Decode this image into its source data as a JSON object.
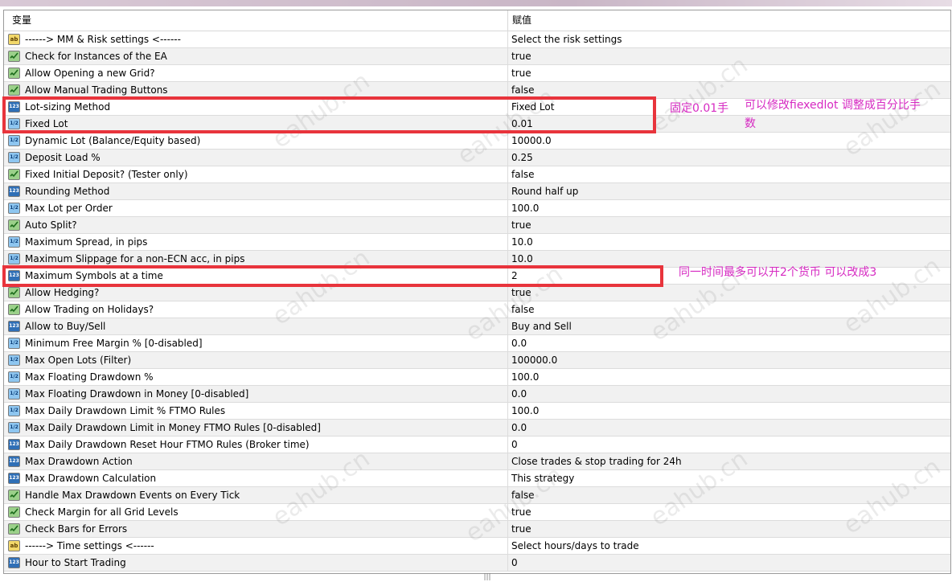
{
  "header": {
    "variable": "变量",
    "value": "赋值"
  },
  "rows": [
    {
      "icon": "ab",
      "label": "------> MM & Risk settings <------",
      "value": "Select the risk settings"
    },
    {
      "icon": "bool",
      "label": "Check for Instances of the EA",
      "value": "true"
    },
    {
      "icon": "bool",
      "label": "Allow Opening a new Grid?",
      "value": "true"
    },
    {
      "icon": "bool",
      "label": "Allow Manual Trading Buttons",
      "value": "false"
    },
    {
      "icon": "123",
      "label": "Lot-sizing Method",
      "value": "Fixed Lot"
    },
    {
      "icon": "v2",
      "label": "Fixed Lot",
      "value": "0.01"
    },
    {
      "icon": "v2",
      "label": "Dynamic Lot (Balance/Equity based)",
      "value": "10000.0"
    },
    {
      "icon": "v2",
      "label": "Deposit Load %",
      "value": "0.25"
    },
    {
      "icon": "bool",
      "label": "Fixed Initial Deposit? (Tester only)",
      "value": "false"
    },
    {
      "icon": "123",
      "label": "Rounding Method",
      "value": "Round half up"
    },
    {
      "icon": "v2",
      "label": "Max Lot per Order",
      "value": "100.0"
    },
    {
      "icon": "bool",
      "label": "Auto Split?",
      "value": "true"
    },
    {
      "icon": "v2",
      "label": "Maximum Spread, in pips",
      "value": "10.0"
    },
    {
      "icon": "v2",
      "label": "Maximum Slippage for a non-ECN acc, in pips",
      "value": "10.0"
    },
    {
      "icon": "123",
      "label": "Maximum Symbols at a time",
      "value": "2"
    },
    {
      "icon": "bool",
      "label": "Allow Hedging?",
      "value": "true"
    },
    {
      "icon": "bool",
      "label": "Allow Trading on Holidays?",
      "value": "false"
    },
    {
      "icon": "123",
      "label": "Allow to Buy/Sell",
      "value": "Buy and Sell"
    },
    {
      "icon": "v2",
      "label": "Minimum Free Margin % [0-disabled]",
      "value": "0.0"
    },
    {
      "icon": "v2",
      "label": "Max Open Lots (Filter)",
      "value": "100000.0"
    },
    {
      "icon": "v2",
      "label": "Max Floating Drawdown %",
      "value": "100.0"
    },
    {
      "icon": "v2",
      "label": "Max Floating Drawdown in Money [0-disabled]",
      "value": "0.0"
    },
    {
      "icon": "v2",
      "label": "Max Daily Drawdown Limit % FTMO Rules",
      "value": "100.0"
    },
    {
      "icon": "v2",
      "label": "Max Daily Drawdown Limit in Money FTMO Rules [0-disabled]",
      "value": "0.0"
    },
    {
      "icon": "123",
      "label": "Max Daily Drawdown Reset Hour FTMO Rules (Broker time)",
      "value": "0"
    },
    {
      "icon": "123",
      "label": "Max Drawdown Action",
      "value": "Close trades & stop trading for 24h"
    },
    {
      "icon": "123",
      "label": "Max Drawdown Calculation",
      "value": "This strategy"
    },
    {
      "icon": "bool",
      "label": "Handle Max Drawdown Events on Every Tick",
      "value": "false"
    },
    {
      "icon": "bool",
      "label": "Check Margin for all Grid Levels",
      "value": "true"
    },
    {
      "icon": "bool",
      "label": "Check Bars for Errors",
      "value": "true"
    },
    {
      "icon": "ab",
      "label": "------> Time settings <------",
      "value": "Select hours/days to trade"
    },
    {
      "icon": "123",
      "label": "Hour to Start Trading",
      "value": "0"
    }
  ],
  "icons": {
    "ab": "ab",
    "123": "123",
    "v2": "1/2"
  },
  "annotations": {
    "note1": "固定0.01手",
    "note2_line1": "可以修改fiexedlot 调整成百分比手",
    "note2_line2": "数",
    "note3": "同一时间最多可以开2个货币 可以改成3"
  },
  "watermark": "eahub.cn",
  "colors": {
    "highlight": "#e8343c",
    "note": "#d62ac2"
  }
}
